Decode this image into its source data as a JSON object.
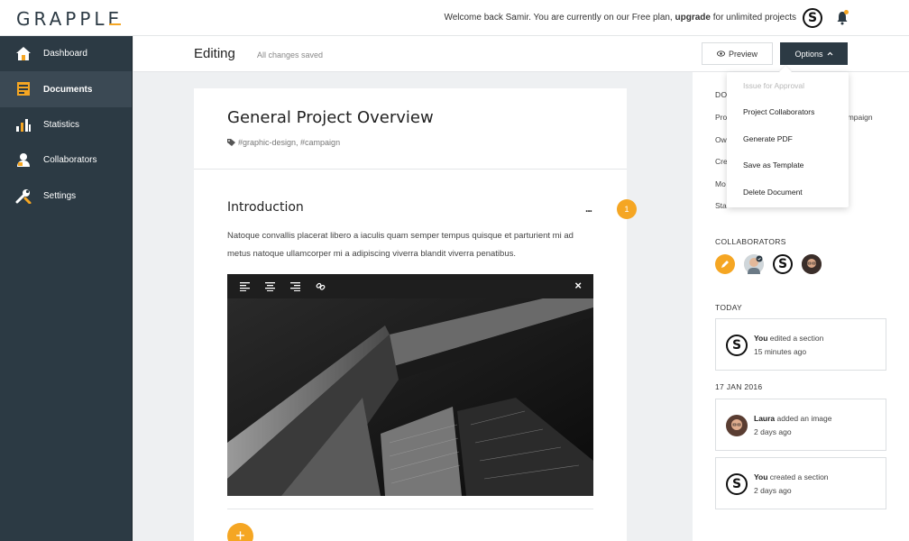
{
  "app": {
    "logo": "GRAPPLE",
    "welcome_prefix": "Welcome back Samir. You are currently on our Free plan, ",
    "welcome_link": "upgrade",
    "welcome_suffix": " for unlimited projects",
    "avatar_letter": "S"
  },
  "sidebar": {
    "items": [
      {
        "label": "Dashboard",
        "icon": "home-icon"
      },
      {
        "label": "Documents",
        "icon": "documents-icon",
        "active": true
      },
      {
        "label": "Statistics",
        "icon": "chart-icon"
      },
      {
        "label": "Collaborators",
        "icon": "user-icon"
      },
      {
        "label": "Settings",
        "icon": "wrench-icon"
      }
    ]
  },
  "header": {
    "title": "Editing",
    "status": "All changes saved",
    "preview_label": "Preview",
    "options_label": "Options"
  },
  "dropdown": {
    "items": [
      {
        "label": "Issue for Approval",
        "disabled": true
      },
      {
        "label": "Project Collaborators"
      },
      {
        "label": "Generate PDF"
      },
      {
        "label": "Save as Template"
      },
      {
        "label": "Delete Document"
      }
    ]
  },
  "document": {
    "title": "General Project Overview",
    "tags": "#graphic-design, #campaign",
    "section_title": "Introduction",
    "more": "...",
    "paragraph": "Natoque convallis placerat libero a iaculis quam semper tempus quisque et parturient mi ad metus natoque ullamcorper mi a adipiscing viverra blandit viverra penatibus.",
    "comment_count": "1",
    "add_label": "+",
    "close_label": "×"
  },
  "right_panel": {
    "doc_label_partial": "DOC",
    "meta_partials": [
      "Pro",
      "Ow",
      "Cre",
      "Mo",
      "Sta"
    ],
    "meta_tail": "ampaign",
    "collaborators_label": "COLLABORATORS",
    "today_label": "TODAY",
    "date_label": "17 JAN 2016",
    "activities": [
      {
        "who": "You",
        "action": " edited a section",
        "time": "15 minutes ago",
        "avatar": "s"
      },
      {
        "who": "Laura",
        "action": " added an image",
        "time": "2 days ago",
        "avatar": "laura"
      },
      {
        "who": "You",
        "action": " created a section",
        "time": "2 days ago",
        "avatar": "s"
      }
    ]
  },
  "colors": {
    "accent": "#f5a623",
    "sidebar": "#2c3a44",
    "sidebar_active": "#3b4954"
  }
}
